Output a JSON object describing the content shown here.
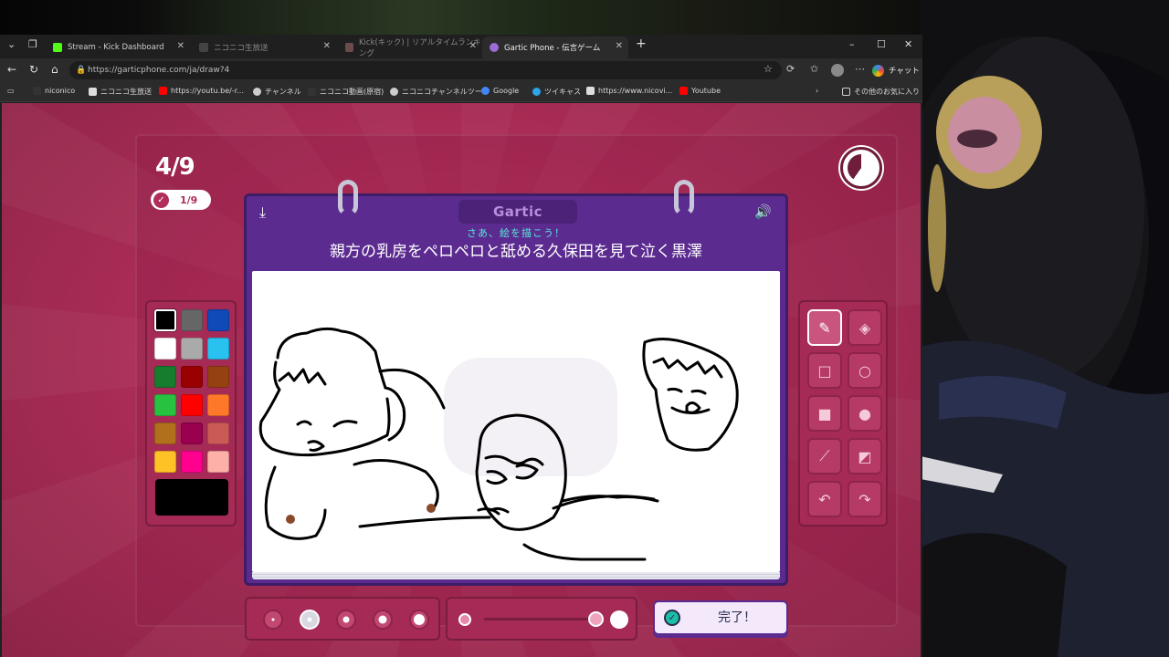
{
  "browser": {
    "tabs": [
      {
        "label": "Stream - Kick Dashboard",
        "icon": "kick-icon",
        "color": "#53fc18"
      },
      {
        "label": "ニコニコ生放送",
        "icon": "niconico-icon",
        "color": "#444444"
      },
      {
        "label": "Kick(キック) | リアルタイムランキング",
        "icon": "ranking-icon",
        "color": "#6b4b4b"
      },
      {
        "label": "Gartic Phone - 伝言ゲーム",
        "icon": "gartic-icon",
        "color": "#9b6bd6"
      }
    ],
    "url": "https://garticphone.com/ja/draw?4",
    "chat_label": "チャット",
    "bookmarks": [
      {
        "label": "niconico",
        "icon": "niconico-bm-icon",
        "color": "#333333"
      },
      {
        "label": "ニコニコ生放送",
        "icon": "nicolive-bm-icon",
        "color": "#dddddd"
      },
      {
        "label": "https://youtu.be/-r...",
        "icon": "youtube-bm-icon",
        "color": "#ff0000"
      },
      {
        "label": "チャンネル",
        "icon": "channel-bm-icon",
        "color": "#cccccc"
      },
      {
        "label": "ニコニコ動画(原宿)",
        "icon": "nicovideo-bm-icon",
        "color": "#333333"
      },
      {
        "label": "ニコニコチャンネルツール",
        "icon": "tool-bm-icon",
        "color": "#cccccc"
      },
      {
        "label": "Google",
        "icon": "google-bm-icon",
        "color": "#4285f4"
      },
      {
        "label": "ツイキャス",
        "icon": "twitcasting-bm-icon",
        "color": "#2fa4e7"
      },
      {
        "label": "https://www.nicovi...",
        "icon": "page-bm-icon",
        "color": "#dddddd"
      },
      {
        "label": "Youtube",
        "icon": "youtube-bm-icon",
        "color": "#ff0000"
      }
    ],
    "other_bookmarks": "その他のお気に入り"
  },
  "game": {
    "counter": "4/9",
    "rounds_done": "1/9",
    "brand": "Gartic",
    "subprompt": "さあ、絵を描こう！",
    "prompt": "親方の乳房をペロペロと舐める久保田を見て泣く黒澤",
    "done_label": "完了！",
    "palette": [
      "#000000",
      "#666666",
      "#1049b8",
      "#ffffff",
      "#aaaaaa",
      "#29c1f0",
      "#167c2e",
      "#990000",
      "#964112",
      "#28c241",
      "#ff0000",
      "#ff7829",
      "#b0701c",
      "#99004e",
      "#cb5a57",
      "#ffc226",
      "#ff008f",
      "#feafa8"
    ],
    "selected_color": "#000000",
    "tools": [
      "pencil-icon",
      "eraser-icon",
      "rectangle-outline-icon",
      "circle-outline-icon",
      "rectangle-fill-icon",
      "circle-fill-icon",
      "line-icon",
      "bucket-icon",
      "undo-icon",
      "redo-icon"
    ],
    "selected_tool": "pencil",
    "brush_sizes": 5,
    "selected_size": 2
  }
}
